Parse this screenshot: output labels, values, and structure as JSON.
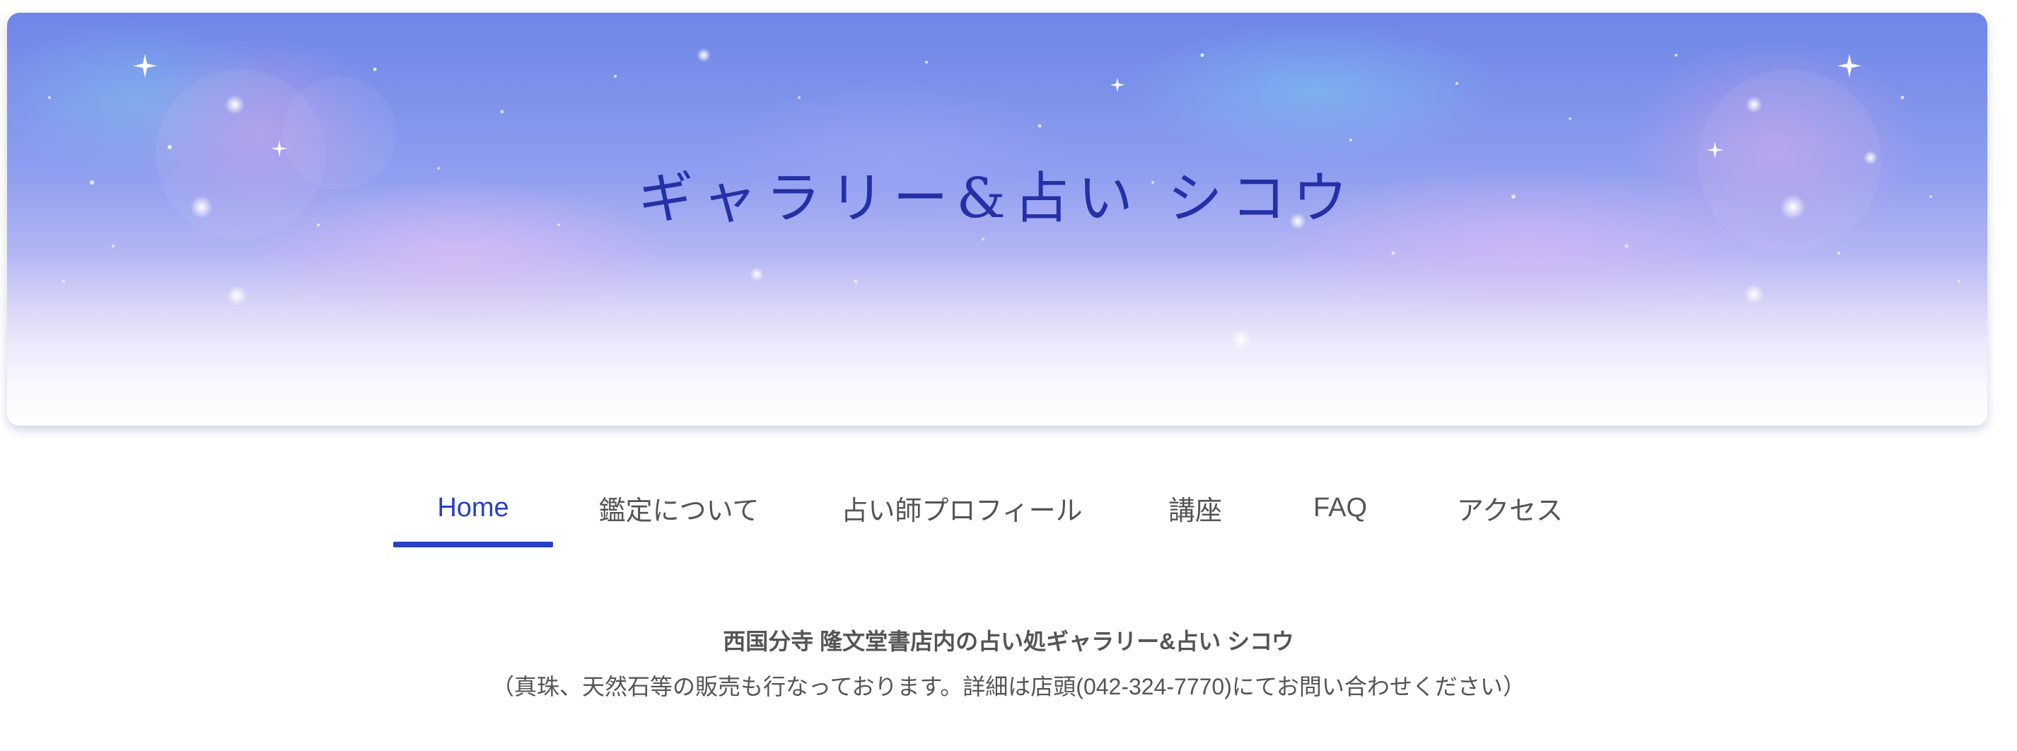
{
  "header": {
    "site_title": "ギャラリー&占い シコウ"
  },
  "nav": {
    "items": [
      {
        "label": "Home",
        "active": true
      },
      {
        "label": "鑑定について",
        "active": false
      },
      {
        "label": "占い師プロフィール",
        "active": false
      },
      {
        "label": "講座",
        "active": false
      },
      {
        "label": "FAQ",
        "active": false
      },
      {
        "label": "アクセス",
        "active": false
      }
    ]
  },
  "intro": {
    "title": "西国分寺 隆文堂書店内の占い処ギャラリー&占い シコウ",
    "note": "（真珠、天然石等の販売も行なっております。詳細は店頭(042-324-7770)にてお問い合わせください）"
  },
  "colors": {
    "accent": "#2840c4",
    "title_text": "#2530a6",
    "body_text": "#555555",
    "sky_top": "#6e86e8"
  }
}
